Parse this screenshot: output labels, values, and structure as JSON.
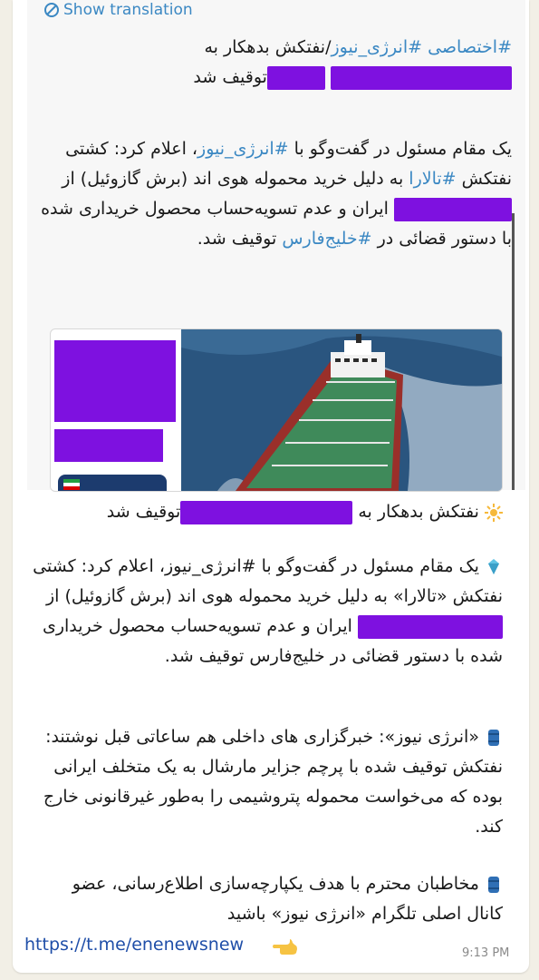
{
  "translate": {
    "label": "Show translation"
  },
  "quote": {
    "title_tag": "#اختصاصی",
    "title_hashtag": "#انرژی_نیوز",
    "title_text": "/نفتکش بدهکار به",
    "title_end": "توقیف شد",
    "body_line1_a": "یک مقام مسئول در گفت‌وگو با",
    "body_line1_tag": "#انرژی_نیوز",
    "body_line1_b": "، اعلام کرد: کشتی نفتکش",
    "body_tag_talara": "#تالارا",
    "body_line2": "به دلیل خرید محموله هوی اند (برش گازوئیل) از",
    "body_line3": "ایران و عدم تسویه‌حساب محصول خریداری شده با دستور قضائی در",
    "body_tag_gulf": "#خلیج‌فارس",
    "body_end": "توقیف شد."
  },
  "message": {
    "p1_start": "نفتکش بدهکار به",
    "p1_end": "توقیف شد",
    "p2_a": "یک مقام مسئول در گفت‌وگو با #انرژی_نیوز، اعلام کرد: کشتی نفتکش «تالارا» به دلیل خرید محموله هوی اند (برش گازوئیل) از",
    "p2_b": "ایران و عدم تسویه‌حساب محصول خریداری شده با دستور قضائی در خلیج‌فارس توقیف شد.",
    "p3": "«انرژی نیوز»: خبرگزاری های داخلی هم ساعاتی قبل نوشتند: نفتکش توقیف شده با پرچم جزایر مارشال به یک متخلف ایرانی بوده که می‌خواست محموله پتروشیمی را به‌طور غیرقانونی خارج کند.",
    "p4": "مخاطبان محترم با هدف یکپارچه‌سازی اطلاع‌رسانی، عضو کانال اصلی تلگرام «انرژی نیوز» باشید",
    "link": "https://t.me/enenewsnew",
    "time": "9:13 PM"
  },
  "colors": {
    "redaction": "#7e11e0",
    "link": "#3b88c3",
    "sea": "#2a557f",
    "deck": "#3f8a5a"
  },
  "icons": [
    "translate-icon",
    "sun-icon",
    "diamond-icon",
    "barrel-icon",
    "pointing-hand-icon"
  ]
}
